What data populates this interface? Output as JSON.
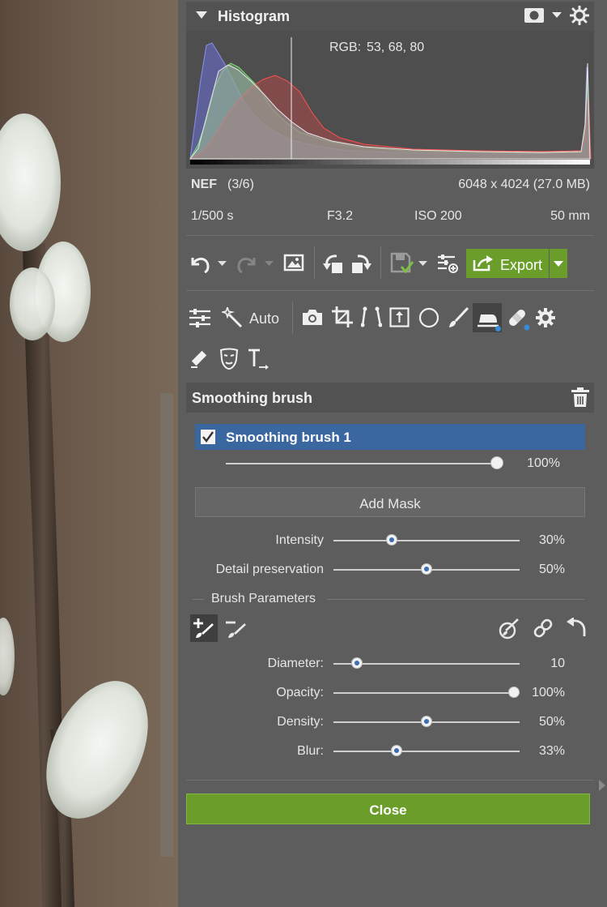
{
  "histogram": {
    "title": "Histogram",
    "rgb_label": "RGB:",
    "rgb_values": "53,  68,  80",
    "icons": [
      "collapse-triangle-icon",
      "mask-view-icon",
      "chevron-down-icon",
      "sun-gear-icon"
    ]
  },
  "file_info": {
    "format": "NEF",
    "position": "(3/6)",
    "dimensions": "6048 x 4024 (27.0 MB)",
    "shutter": "1/500 s",
    "aperture": "F3.2",
    "iso": "ISO 200",
    "focal": "50 mm"
  },
  "toolbar": {
    "export_label": "Export"
  },
  "tools": {
    "auto_label": "Auto"
  },
  "section": {
    "title": "Smoothing brush"
  },
  "layer": {
    "name": "Smoothing brush 1",
    "checked": true,
    "opacity": 100,
    "opacity_text": "100%"
  },
  "add_mask_label": "Add Mask",
  "effect_sliders": [
    {
      "label": "Intensity",
      "value": 30,
      "text": "30%"
    },
    {
      "label": "Detail preservation",
      "value": 50,
      "text": "50%"
    }
  ],
  "brush_params_title": "Brush Parameters",
  "brush_sliders": [
    {
      "label": "Diameter:",
      "value": 10,
      "text": "10"
    },
    {
      "label": "Opacity:",
      "value": 100,
      "text": "100%"
    },
    {
      "label": "Density:",
      "value": 50,
      "text": "50%"
    },
    {
      "label": "Blur:",
      "value": 33,
      "text": "33%"
    }
  ],
  "close_label": "Close",
  "colors": {
    "accent_green": "#6a9d2a",
    "selection_blue": "#3a67a0"
  }
}
